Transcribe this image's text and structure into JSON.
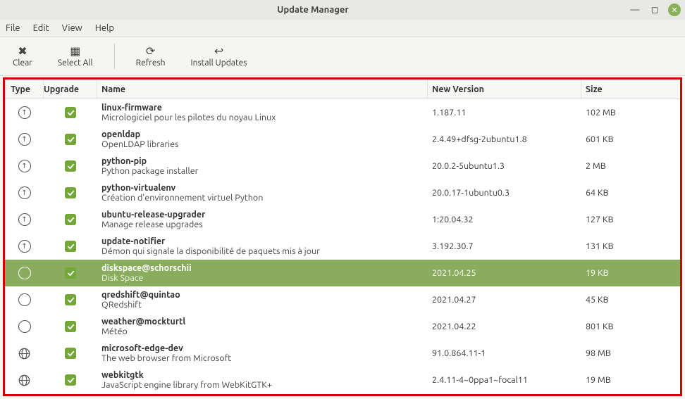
{
  "window": {
    "title": "Update Manager"
  },
  "menu": {
    "file": "File",
    "edit": "Edit",
    "view": "View",
    "help": "Help"
  },
  "toolbar": {
    "clear": "Clear",
    "select_all": "Select All",
    "refresh": "Refresh",
    "install": "Install Updates"
  },
  "columns": {
    "type": "Type",
    "upgrade": "Upgrade",
    "name": "Name",
    "version": "New Version",
    "size": "Size"
  },
  "packages": [
    {
      "type": "up",
      "checked": true,
      "name": "linux-firmware",
      "desc": "Micrologiciel pour les pilotes du noyau Linux",
      "version": "1.187.11",
      "size": "102 MB",
      "selected": false
    },
    {
      "type": "up",
      "checked": true,
      "name": "openldap",
      "desc": "OpenLDAP libraries",
      "version": "2.4.49+dfsg-2ubuntu1.8",
      "size": "601 KB",
      "selected": false
    },
    {
      "type": "up",
      "checked": true,
      "name": "python-pip",
      "desc": "Python package installer",
      "version": "20.0.2-5ubuntu1.3",
      "size": "2 MB",
      "selected": false
    },
    {
      "type": "up",
      "checked": true,
      "name": "python-virtualenv",
      "desc": "Création d'environnement virtuel Python",
      "version": "20.0.17-1ubuntu0.3",
      "size": "64 KB",
      "selected": false
    },
    {
      "type": "up",
      "checked": true,
      "name": "ubuntu-release-upgrader",
      "desc": "Manage release upgrades",
      "version": "1:20.04.32",
      "size": "127 KB",
      "selected": false
    },
    {
      "type": "up",
      "checked": true,
      "name": "update-notifier",
      "desc": "Démon qui signale la disponibilité de paquets mis à jour",
      "version": "3.192.30.7",
      "size": "131 KB",
      "selected": false
    },
    {
      "type": "moon",
      "checked": true,
      "name": "diskspace@schorschii",
      "desc": "Disk Space",
      "version": "2021.04.25",
      "size": "19 KB",
      "selected": true
    },
    {
      "type": "moon",
      "checked": true,
      "name": "qredshift@quintao",
      "desc": "QRedshift",
      "version": "2021.04.27",
      "size": "45 KB",
      "selected": false
    },
    {
      "type": "moon",
      "checked": true,
      "name": "weather@mockturtl",
      "desc": "Météo",
      "version": "2021.04.22",
      "size": "801 KB",
      "selected": false
    },
    {
      "type": "globe",
      "checked": true,
      "name": "microsoft-edge-dev",
      "desc": "The web browser from Microsoft",
      "version": "91.0.864.11-1",
      "size": "98 MB",
      "selected": false
    },
    {
      "type": "globe",
      "checked": true,
      "name": "webkitgtk",
      "desc": "JavaScript engine library from WebKitGTK+",
      "version": "2.4.11-4~0ppa1~focal11",
      "size": "19 MB",
      "selected": false
    }
  ]
}
